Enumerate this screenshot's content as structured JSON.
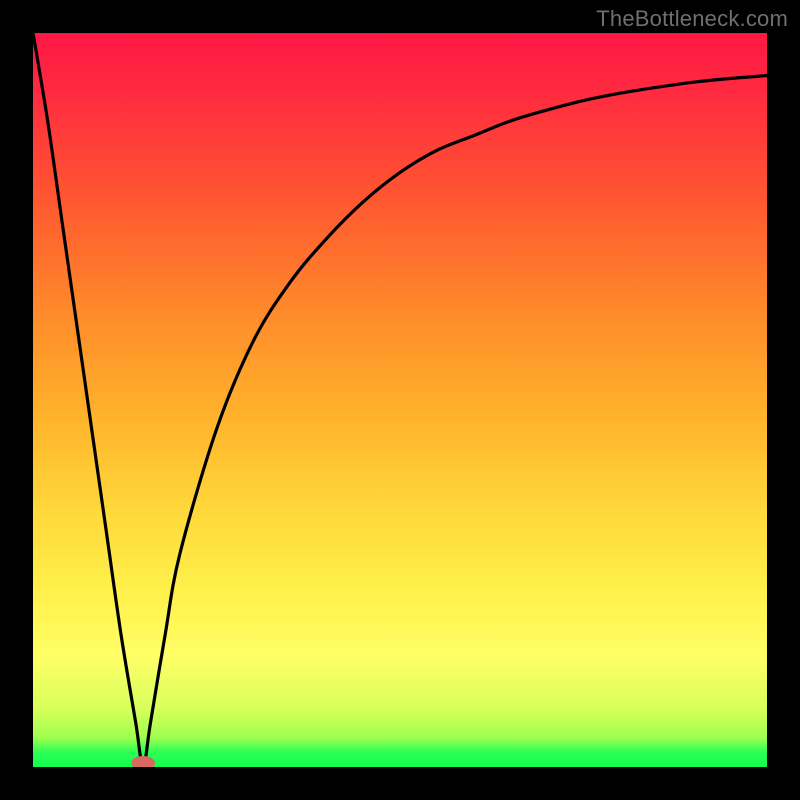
{
  "watermark": {
    "text": "TheBottleneck.com"
  },
  "colors": {
    "frame": "#000000",
    "curve": "#000000",
    "gradient_stops": [
      "#ff1744",
      "#ff5531",
      "#ffb22b",
      "#ffff66",
      "#9eff4f",
      "#12ff4e"
    ],
    "marker": "#d86a62"
  },
  "chart_data": {
    "type": "line",
    "title": "",
    "xlabel": "",
    "ylabel": "",
    "xlim": [
      0,
      100
    ],
    "ylim": [
      0,
      100
    ],
    "x": [
      0,
      2,
      4,
      6,
      8,
      10,
      12,
      14,
      15,
      16,
      18,
      20,
      25,
      30,
      35,
      40,
      45,
      50,
      55,
      60,
      65,
      70,
      75,
      80,
      85,
      90,
      95,
      100
    ],
    "y": [
      100,
      88,
      74,
      60,
      46,
      32,
      18,
      6,
      0,
      6,
      18,
      29,
      46,
      58,
      66,
      72,
      77,
      81,
      84,
      86,
      88,
      89.5,
      90.8,
      91.8,
      92.6,
      93.3,
      93.8,
      94.2
    ],
    "annotations": [
      {
        "name": "minimum-marker",
        "x": 15,
        "y": 0
      }
    ]
  }
}
